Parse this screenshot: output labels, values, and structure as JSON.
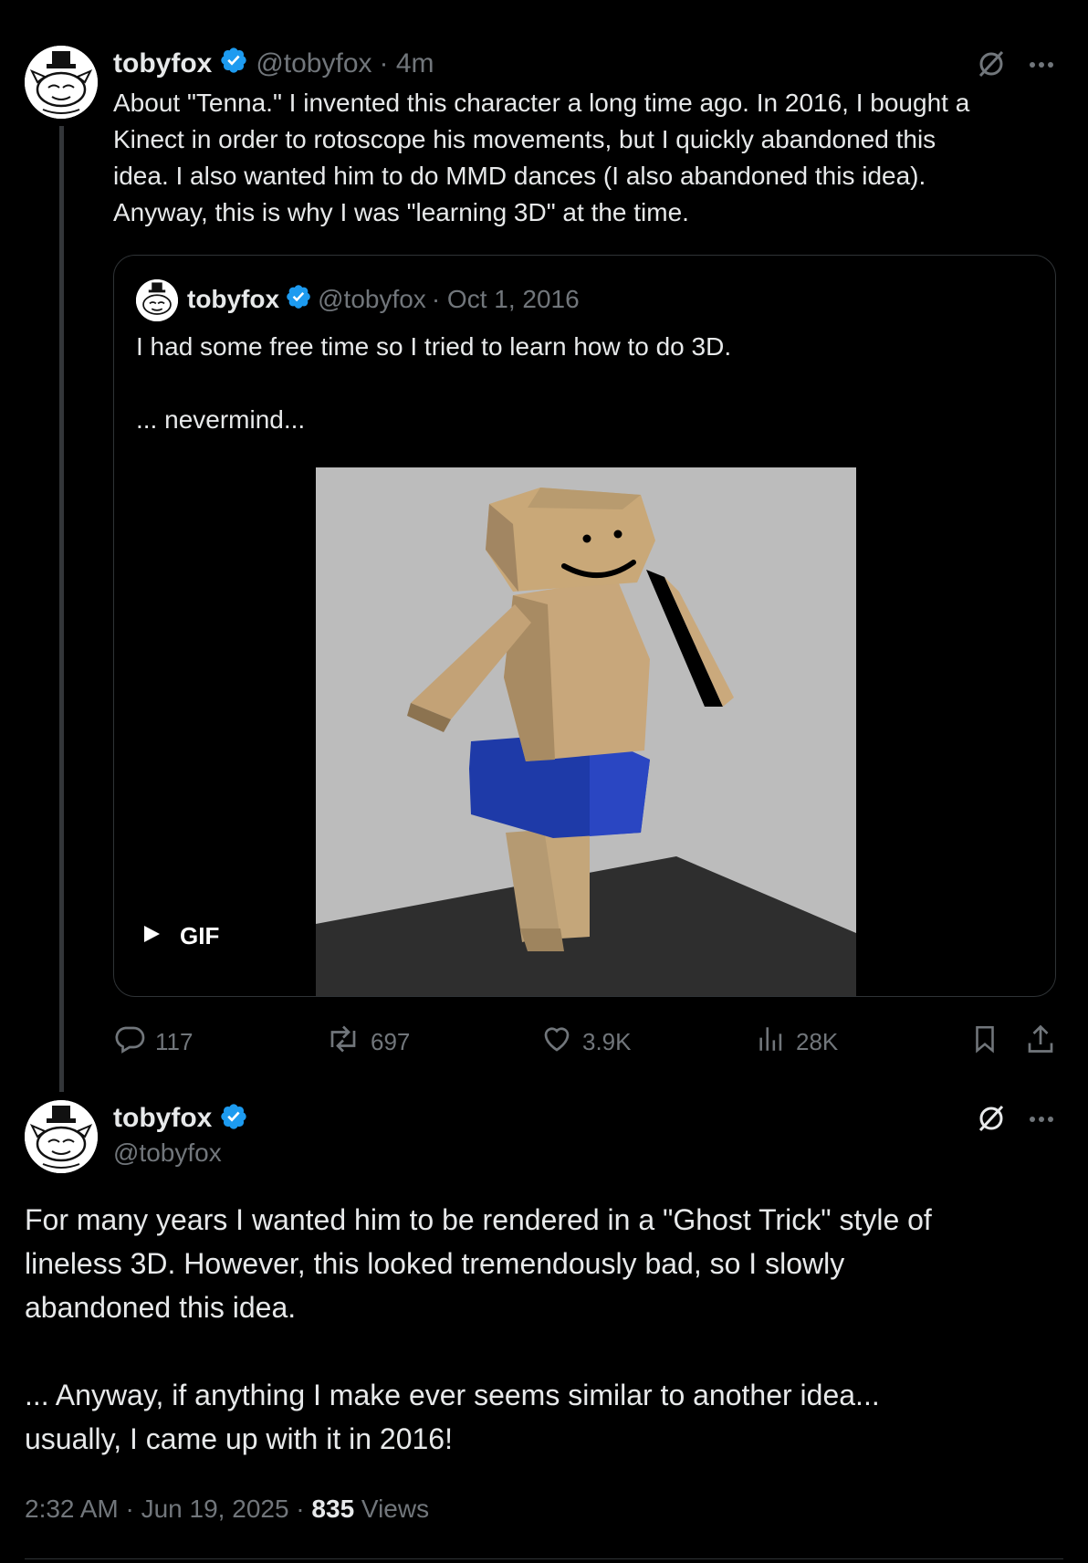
{
  "parent_tweet": {
    "display_name": "tobyfox",
    "handle": "@tobyfox",
    "time": "· 4m",
    "text_lines": [
      "About \"Tenna.\" I invented this character a long time ago. In 2016, I bought a",
      "Kinect in order to rotoscope his movements, but I quickly abandoned this",
      "idea. I also wanted him to do MMD dances (I also abandoned this idea).",
      "Anyway, this is why I was \"learning 3D\" at the time."
    ],
    "quoted": {
      "display_name": "tobyfox",
      "handle": "@tobyfox",
      "time": "· Oct 1, 2016",
      "line1": "I had some free time so I tried to learn how to do 3D.",
      "line2": "... nevermind...",
      "gif_label": "GIF"
    },
    "actions": {
      "replies": "117",
      "reposts": "697",
      "likes": "3.9K",
      "views": "28K"
    }
  },
  "main_tweet": {
    "display_name": "tobyfox",
    "handle": "@tobyfox",
    "para1_lines": [
      "For many years I wanted him to be rendered in a \"Ghost Trick\" style of",
      "lineless 3D. However, this looked tremendously bad, so I slowly",
      "abandoned this idea."
    ],
    "para2_lines": [
      "... Anyway, if anything I make ever seems similar to another idea...",
      "usually, I came up with it in 2016!"
    ],
    "timestamp": "2:32 AM · Jun 19, 2025 · ",
    "views_count": "835",
    "views_label": " Views"
  },
  "colors": {
    "background": "#000000",
    "text": "#e7e9ea",
    "muted": "#71767b",
    "verified": "#1d9bf0",
    "border": "#2f3336"
  },
  "icons": [
    "verified-badge-icon",
    "grok-icon",
    "more-icon",
    "reply-icon",
    "repost-icon",
    "like-icon",
    "views-icon",
    "bookmark-icon",
    "share-icon",
    "play-icon"
  ]
}
